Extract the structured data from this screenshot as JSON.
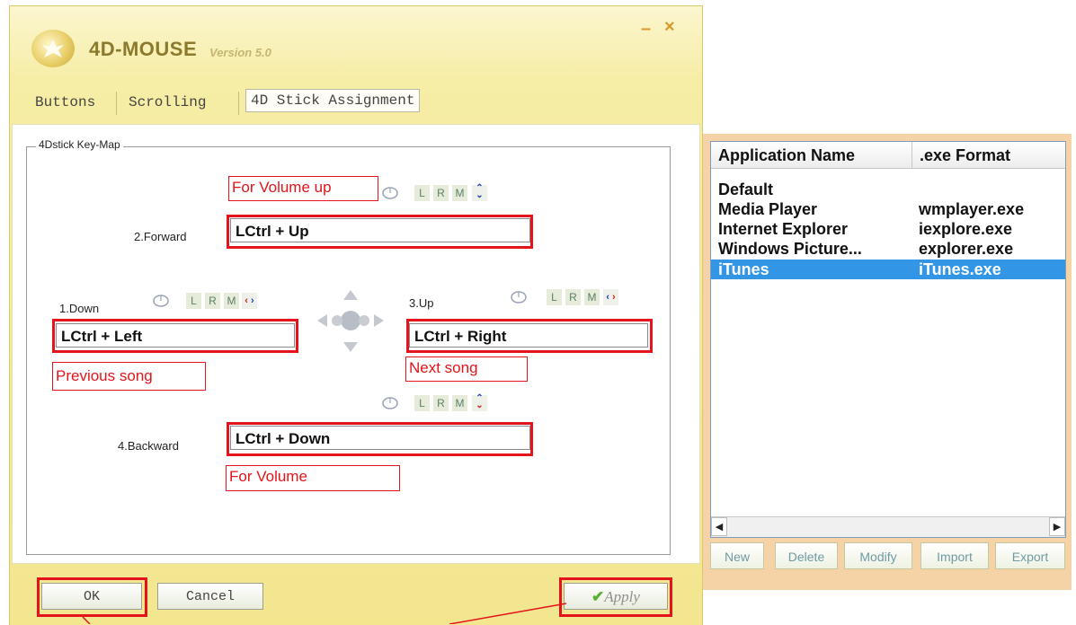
{
  "window": {
    "title": "4D-MOUSE",
    "version": "Version 5.0",
    "minimize_glyph": "–",
    "close_glyph": "×"
  },
  "tabs": [
    {
      "label": "Buttons"
    },
    {
      "label": "Scrolling"
    },
    {
      "label": "4D Stick Assignment",
      "active": true
    }
  ],
  "keymap": {
    "group_title": "4Dstick Key-Map",
    "button_labels": {
      "left": "L",
      "right": "R",
      "middle": "M"
    },
    "forward": {
      "label": "2.Forward",
      "value": "LCtrl + Up",
      "annotation": "For Volume up"
    },
    "down": {
      "label": "1.Down",
      "value": "LCtrl + Left",
      "annotation": "Previous song"
    },
    "up": {
      "label": "3.Up",
      "value": "LCtrl + Right",
      "annotation": "Next song"
    },
    "backward": {
      "label": "4.Backward",
      "value": "LCtrl + Down",
      "annotation": "For Volume"
    }
  },
  "actions": {
    "ok": "OK",
    "cancel": "Cancel",
    "apply": "Apply"
  },
  "apps": {
    "columns": [
      "Application Name",
      ".exe Format"
    ],
    "rows": [
      {
        "name": "Default",
        "exe": ""
      },
      {
        "name": "Media Player",
        "exe": "wmplayer.exe"
      },
      {
        "name": "Internet Explorer",
        "exe": "iexplore.exe"
      },
      {
        "name": "Windows Picture...",
        "exe": "explorer.exe"
      },
      {
        "name": "iTunes",
        "exe": "iTunes.exe",
        "selected": true
      }
    ],
    "buttons": [
      "New",
      "Delete",
      "Modify",
      "Import",
      "Export"
    ]
  },
  "colors": {
    "annotation_red": "#e3141b",
    "selection_blue": "#3395e5",
    "panel_orange": "#f5d3a6",
    "window_yellow": "#f3e68f"
  }
}
